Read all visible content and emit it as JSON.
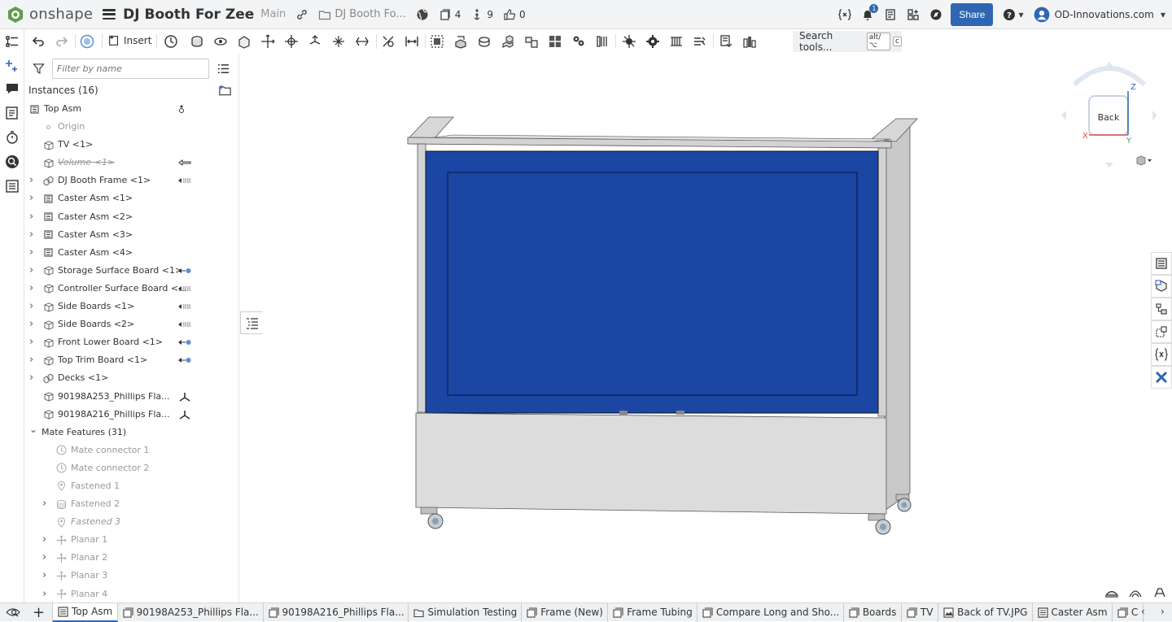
{
  "app": {
    "name": "onshape",
    "accent": "#2f66b3",
    "logo_green": "#5e9e4a"
  },
  "header": {
    "doc_title": "DJ Booth For Zee",
    "workspace": "Main",
    "folder": "DJ Booth Fo...",
    "versions_count": "4",
    "branches_count": "9",
    "likes_count": "0",
    "notifications_count": "1",
    "share_label": "Share",
    "account_name": "OD-Innovations.com"
  },
  "toolbar": {
    "insert_label": "Insert",
    "search_label": "Search tools...",
    "search_kbd_1": "alt/⌥",
    "search_kbd_2": "c"
  },
  "panel": {
    "filter_placeholder": "Filter by name",
    "instances_header": "Instances (16)",
    "items": [
      {
        "label": "Top Asm",
        "level": 0,
        "expander": false,
        "icon": "assembly-icon",
        "style": "normal",
        "tag": "mate-pin-icon"
      },
      {
        "label": "Origin",
        "level": 1,
        "expander": false,
        "icon": "origin-icon",
        "style": "dim",
        "tag": ""
      },
      {
        "label": "TV <1>",
        "level": 1,
        "expander": false,
        "icon": "part-icon",
        "style": "normal",
        "tag": ""
      },
      {
        "label": "Volume <1>",
        "level": 1,
        "expander": false,
        "icon": "part-icon",
        "style": "strike",
        "tag": "arrow-left-icon"
      },
      {
        "label": "DJ Booth Frame <1>",
        "level": 1,
        "expander": true,
        "icon": "subassembly-icon",
        "style": "normal",
        "tag": "arrow-dashed-icon"
      },
      {
        "label": "Caster Asm <1>",
        "level": 1,
        "expander": true,
        "icon": "assembly-icon",
        "style": "normal",
        "tag": ""
      },
      {
        "label": "Caster Asm <2>",
        "level": 1,
        "expander": true,
        "icon": "assembly-icon",
        "style": "normal",
        "tag": ""
      },
      {
        "label": "Caster Asm <3>",
        "level": 1,
        "expander": true,
        "icon": "assembly-icon",
        "style": "normal",
        "tag": ""
      },
      {
        "label": "Caster Asm <4>",
        "level": 1,
        "expander": true,
        "icon": "assembly-icon",
        "style": "normal",
        "tag": ""
      },
      {
        "label": "Storage Surface Board <1>",
        "level": 1,
        "expander": true,
        "icon": "part-icon",
        "style": "normal",
        "tag": "arrow-dot-icon"
      },
      {
        "label": "Controller Surface Board <...",
        "level": 1,
        "expander": true,
        "icon": "part-icon",
        "style": "normal",
        "tag": "arrow-dashed-icon"
      },
      {
        "label": "Side Boards <1>",
        "level": 1,
        "expander": true,
        "icon": "part-icon",
        "style": "normal",
        "tag": "arrow-dashed-icon"
      },
      {
        "label": "Side Boards <2>",
        "level": 1,
        "expander": true,
        "icon": "part-icon",
        "style": "normal",
        "tag": "arrow-dashed-icon"
      },
      {
        "label": "Front Lower Board <1>",
        "level": 1,
        "expander": true,
        "icon": "part-icon",
        "style": "normal",
        "tag": "arrow-dot-icon"
      },
      {
        "label": "Top Trim Board <1>",
        "level": 1,
        "expander": true,
        "icon": "part-icon",
        "style": "normal",
        "tag": "arrow-dot-icon"
      },
      {
        "label": "Decks <1>",
        "level": 1,
        "expander": true,
        "icon": "subassembly-icon",
        "style": "normal",
        "tag": ""
      },
      {
        "label": "90198A253_Phillips Fla...",
        "level": 1,
        "expander": false,
        "icon": "part-icon",
        "style": "normal",
        "tag": "triad-icon"
      },
      {
        "label": "90198A216_Phillips Fla...",
        "level": 1,
        "expander": false,
        "icon": "part-icon",
        "style": "normal",
        "tag": "triad-icon"
      },
      {
        "label": "Mate Features (31)",
        "level": 0,
        "expander": "open",
        "icon": "",
        "style": "normal",
        "tag": ""
      },
      {
        "label": "Mate connector 1",
        "level": 2,
        "expander": false,
        "icon": "mate-connector-icon",
        "style": "dim",
        "tag": ""
      },
      {
        "label": "Mate connector 2",
        "level": 2,
        "expander": false,
        "icon": "mate-connector-icon",
        "style": "dim",
        "tag": ""
      },
      {
        "label": "Fastened 1",
        "level": 2,
        "expander": false,
        "icon": "fastened-icon",
        "style": "dim",
        "tag": ""
      },
      {
        "label": "Fastened 2",
        "level": 2,
        "expander": true,
        "icon": "fastened-group-icon",
        "style": "dim",
        "tag": ""
      },
      {
        "label": "Fastened 3",
        "level": 2,
        "expander": false,
        "icon": "fastened-icon",
        "style": "dim-ital",
        "tag": ""
      },
      {
        "label": "Planar 1",
        "level": 2,
        "expander": true,
        "icon": "planar-icon",
        "style": "dim",
        "tag": ""
      },
      {
        "label": "Planar 2",
        "level": 2,
        "expander": true,
        "icon": "planar-icon",
        "style": "dim",
        "tag": ""
      },
      {
        "label": "Planar 3",
        "level": 2,
        "expander": true,
        "icon": "planar-icon",
        "style": "dim",
        "tag": ""
      },
      {
        "label": "Planar 4",
        "level": 2,
        "expander": true,
        "icon": "planar-icon",
        "style": "dim",
        "tag": ""
      }
    ]
  },
  "viewcube": {
    "face_label": "Back",
    "axis_z": "Z",
    "axis_x": "X",
    "axis_y": "Y"
  },
  "tabs": [
    {
      "label": "Top Asm",
      "icon": "assembly-icon",
      "active": true
    },
    {
      "label": "90198A253_Phillips Fla...",
      "icon": "partstudio-icon",
      "active": false
    },
    {
      "label": "90198A216_Phillips Fla...",
      "icon": "partstudio-icon",
      "active": false
    },
    {
      "label": "Simulation Testing",
      "icon": "folder-icon",
      "active": false
    },
    {
      "label": "Frame (New)",
      "icon": "partstudio-icon",
      "active": false
    },
    {
      "label": "Frame Tubing",
      "icon": "partstudio-icon",
      "active": false
    },
    {
      "label": "Compare Long and Sho...",
      "icon": "partstudio-icon",
      "active": false
    },
    {
      "label": "Boards",
      "icon": "partstudio-icon",
      "active": false
    },
    {
      "label": "TV",
      "icon": "partstudio-icon",
      "active": false
    },
    {
      "label": "Back of TV.JPG",
      "icon": "image-icon",
      "active": false
    },
    {
      "label": "Caster Asm",
      "icon": "assembly-icon",
      "active": false
    },
    {
      "label": "C",
      "icon": "partstudio-icon",
      "active": false
    }
  ],
  "colors": {
    "panel_blue": "#1c46a3",
    "frame_gray": "#dcdcdc",
    "header_bg": "#f3f4f6"
  }
}
